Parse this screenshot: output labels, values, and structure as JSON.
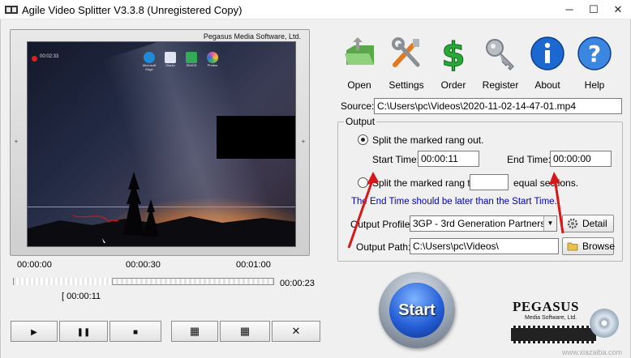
{
  "window": {
    "title": "Agile Video Splitter V3.3.8 (Unregistered Copy)",
    "minimize": "─",
    "maximize": "☐",
    "close": "✕"
  },
  "video": {
    "brand": "Pegasus Media Software, Ltd.",
    "recording_label": "00:02:33",
    "desktop_icons": [
      {
        "label": "Microsoft Edge",
        "color": "#1f8ad8"
      },
      {
        "label": "Dlaulu",
        "color": "#e0e0f0"
      },
      {
        "label": "SIMOS",
        "color": "#33aa55"
      },
      {
        "label": "Photos",
        "color": "#e85a9a"
      }
    ],
    "side_marker": "+"
  },
  "timeline": {
    "mark_start": "00:00:00",
    "mark_mid": "00:00:30",
    "mark_end": "00:01:00",
    "current_time": "00:00:23",
    "selection_start": "[ 00:00:11",
    "position_fraction": 0.38
  },
  "transport": [
    {
      "name": "play-button",
      "glyph": "▶"
    },
    {
      "name": "pause-button",
      "glyph": "❚❚"
    },
    {
      "name": "stop-button",
      "glyph": "■"
    },
    {
      "name": "mark-start-button",
      "glyph": "▦"
    },
    {
      "name": "mark-end-button",
      "glyph": "▦"
    },
    {
      "name": "clear-marks-button",
      "glyph": "✕"
    }
  ],
  "toolbar": {
    "open": "Open",
    "settings": "Settings",
    "order": "Order",
    "register": "Register",
    "about": "About",
    "help": "Help"
  },
  "source": {
    "label": "Source:",
    "path": "C:\\Users\\pc\\Videos\\2020-11-02-14-47-01.mp4"
  },
  "output": {
    "legend": "Output",
    "option1": "Split the marked rang out.",
    "start_time_label": "Start Time:",
    "start_time": "00:00:11",
    "end_time_label": "End Time:",
    "end_time": "00:00:00",
    "option2_prefix": "Split the marked rang to",
    "option2_value": "",
    "option2_suffix": "equal sections.",
    "warning": "The End Time should be later than the Start Time.",
    "profile_label": "Output Profile:",
    "profile_value": "3GP - 3rd Generation Partnership P",
    "detail_button": "Detail",
    "path_label": "Output Path:",
    "path_value": "C:\\Users\\pc\\Videos\\",
    "browse_button": "Browse"
  },
  "start_button": "Start",
  "logo": {
    "name": "PEGASUS",
    "sub": "Media Software, Ltd."
  },
  "watermark": "www.xiazaiba.com",
  "colors": {
    "accent_red_arrow": "#d81818",
    "warning_blue": "#0000c8",
    "start_blue": "#2660d8"
  }
}
